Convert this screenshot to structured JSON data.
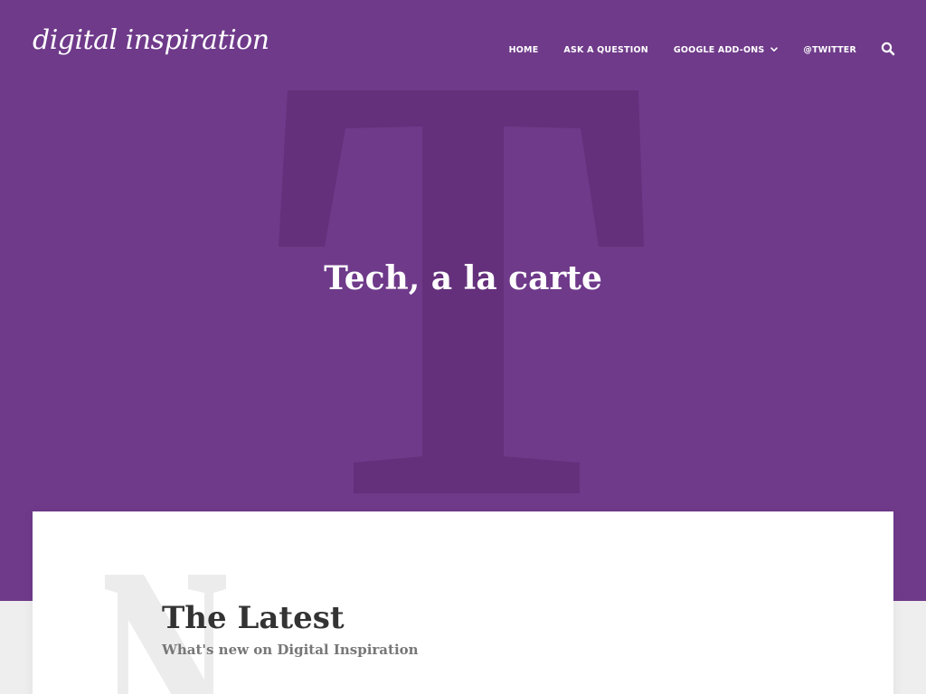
{
  "site": {
    "logo_text": "digital inspiration"
  },
  "nav": {
    "items": [
      {
        "label": "HOME"
      },
      {
        "label": "ASK A QUESTION"
      },
      {
        "label": "GOOGLE ADD-ONS"
      },
      {
        "label": "@TWITTER"
      }
    ],
    "search_icon": "search-icon",
    "dropdown_icon": "chevron-down-icon"
  },
  "hero": {
    "title": "Tech, a la carte",
    "decorative_letter": "T",
    "background_color": "#6f3a8a",
    "letter_color": "#64307b"
  },
  "latest": {
    "decorative_letter": "N",
    "title": "The Latest",
    "subtitle": "What's new on Digital Inspiration"
  },
  "colors": {
    "page_background": "#eeeeee",
    "card_background": "#ffffff",
    "heading_text": "#333333",
    "muted_text": "#777777",
    "deco_letter_light": "#ececec"
  }
}
